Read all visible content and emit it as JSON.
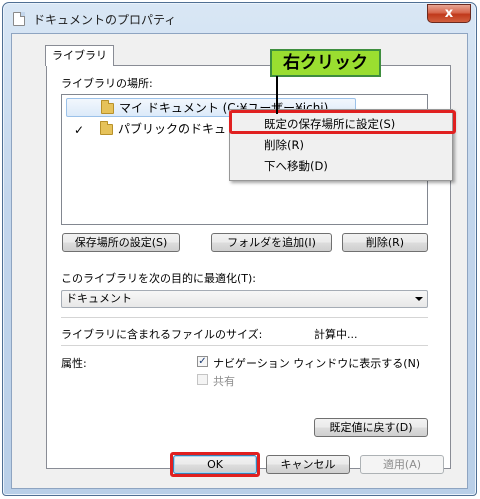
{
  "window": {
    "title": "ドキュメントのプロパティ",
    "close_glyph": "x"
  },
  "tab": {
    "label": "ライブラリ"
  },
  "locations": {
    "label": "ライブラリの場所:",
    "items": [
      {
        "text": "マイ ドキュメント (C:¥ユーザー¥ichi)",
        "check": "",
        "selected": true
      },
      {
        "text": "パブリックのドキュ",
        "check": "✓",
        "selected": false
      }
    ]
  },
  "context_menu": {
    "items": [
      "既定の保存場所に設定(S)",
      "削除(R)",
      "下へ移動(D)"
    ]
  },
  "annotation": {
    "callout": "右クリック",
    "highlight_color": "#e02020",
    "callout_color": "#9ade30"
  },
  "buttons": {
    "set_save_location": "保存場所の設定(S)",
    "add_folder": "フォルダを追加(I)",
    "remove": "削除(R)"
  },
  "optimize": {
    "label": "このライブラリを次の目的に最適化(T):",
    "selected": "ドキュメント"
  },
  "size": {
    "label": "ライブラリに含まれるファイルのサイズ:",
    "value": "計算中..."
  },
  "attributes": {
    "label": "属性:",
    "show_in_nav": {
      "label": "ナビゲーション ウィンドウに表示する(N)",
      "checked": true
    },
    "shared": {
      "label": "共有",
      "checked": false
    }
  },
  "restore_defaults": "既定値に戻す(D)",
  "dialog_buttons": {
    "ok": "OK",
    "cancel": "キャンセル",
    "apply": "適用(A)"
  }
}
